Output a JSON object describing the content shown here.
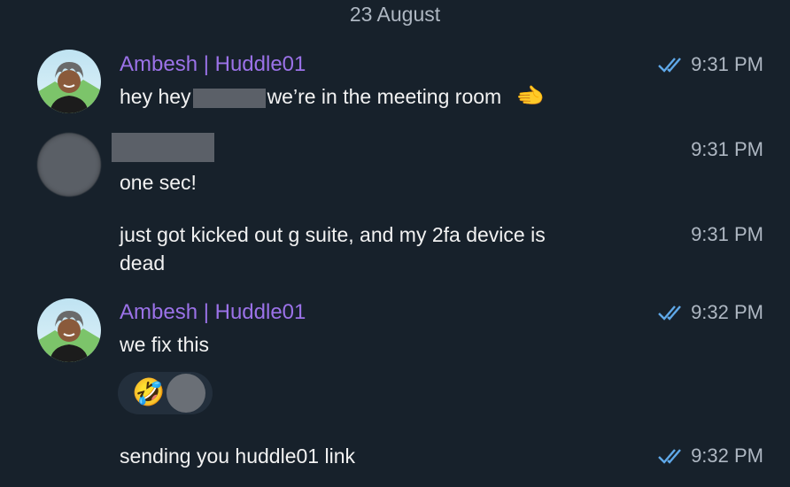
{
  "date_separator": "23 August",
  "messages": [
    {
      "sender": "Ambesh | Huddle01",
      "text_before": "hey hey",
      "text_after": "we’re in the meeting room",
      "emoji": "🫲",
      "time": "9:31 PM",
      "read": true
    },
    {
      "sender": "",
      "text": "one sec!",
      "time": "9:31 PM",
      "read": false
    },
    {
      "text_line1": "just got kicked out g suite, and my 2fa device is",
      "text_line2": "dead",
      "time": "9:31 PM",
      "read": false
    },
    {
      "sender": "Ambesh | Huddle01",
      "text": "we fix this",
      "time": "9:32 PM",
      "read": true,
      "reaction": {
        "emoji": "🤣"
      }
    },
    {
      "text": "sending you huddle01 link",
      "time": "9:32 PM",
      "read": true
    }
  ],
  "colors": {
    "background": "#17212b",
    "sender_name": "#9b72e8",
    "read_check": "#5fa8e8",
    "time": "#aeb7c2"
  },
  "icons": {
    "read": "double-check-icon",
    "avatar": "avatar-icon"
  }
}
